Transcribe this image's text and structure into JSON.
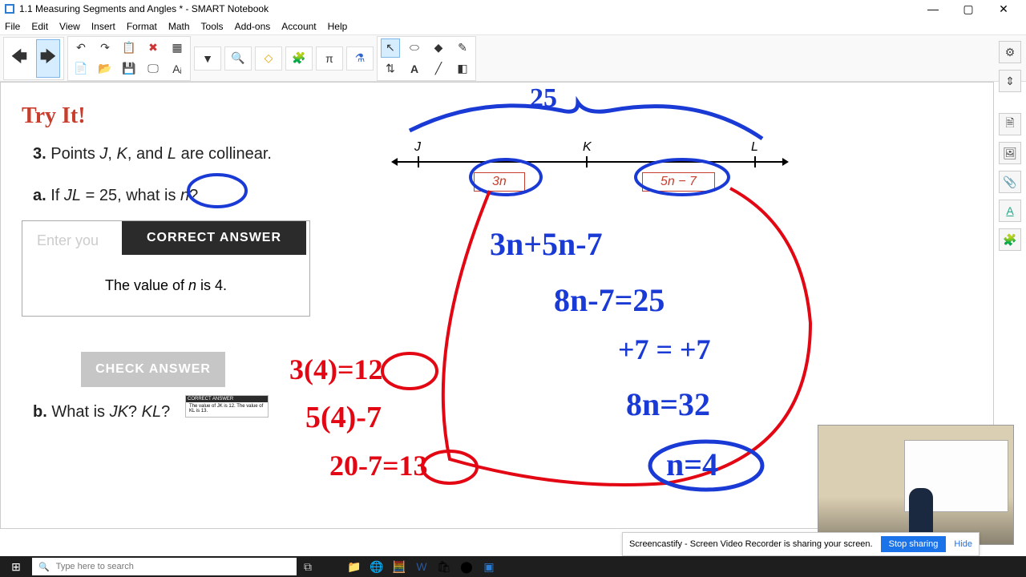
{
  "window": {
    "title": "1.1 Measuring Segments and Angles * - SMART Notebook",
    "minimize": "—",
    "maximize": "▢",
    "close": "✕"
  },
  "menu": [
    "File",
    "Edit",
    "View",
    "Insert",
    "Format",
    "Math",
    "Tools",
    "Add-ons",
    "Account",
    "Help"
  ],
  "content": {
    "try_it": "Try It!",
    "q3": "3. Points J, K, and L are collinear.",
    "qa": "a. If JL = 25, what is n?",
    "enter_placeholder": "Enter you",
    "correct_answer": "CORRECT ANSWER",
    "value_text": "The value of n is 4.",
    "check_answer": "CHECK ANSWER",
    "qb": "b. What is JK? KL?",
    "tooltip_hdr": "CORRECT ANSWER",
    "tooltip_body": "The value of JK is 12. The value of KL is 13."
  },
  "diagram": {
    "points": [
      "J",
      "K",
      "L"
    ],
    "expr1": "3n",
    "expr2": "5n − 7"
  },
  "handwriting": {
    "top25": "25",
    "line1": "3n+5n-7",
    "line2": "8n-7=25",
    "line3": "+7 = +7",
    "line4": "8n=32",
    "line5": "n=4",
    "red1": "3(4)=12",
    "red2": "5(4)-7",
    "red3": "20-7=13"
  },
  "notification": {
    "text": "Screencastify - Screen Video Recorder is sharing your screen.",
    "stop": "Stop sharing",
    "hide": "Hide"
  },
  "taskbar": {
    "search_placeholder": "Type here to search"
  }
}
